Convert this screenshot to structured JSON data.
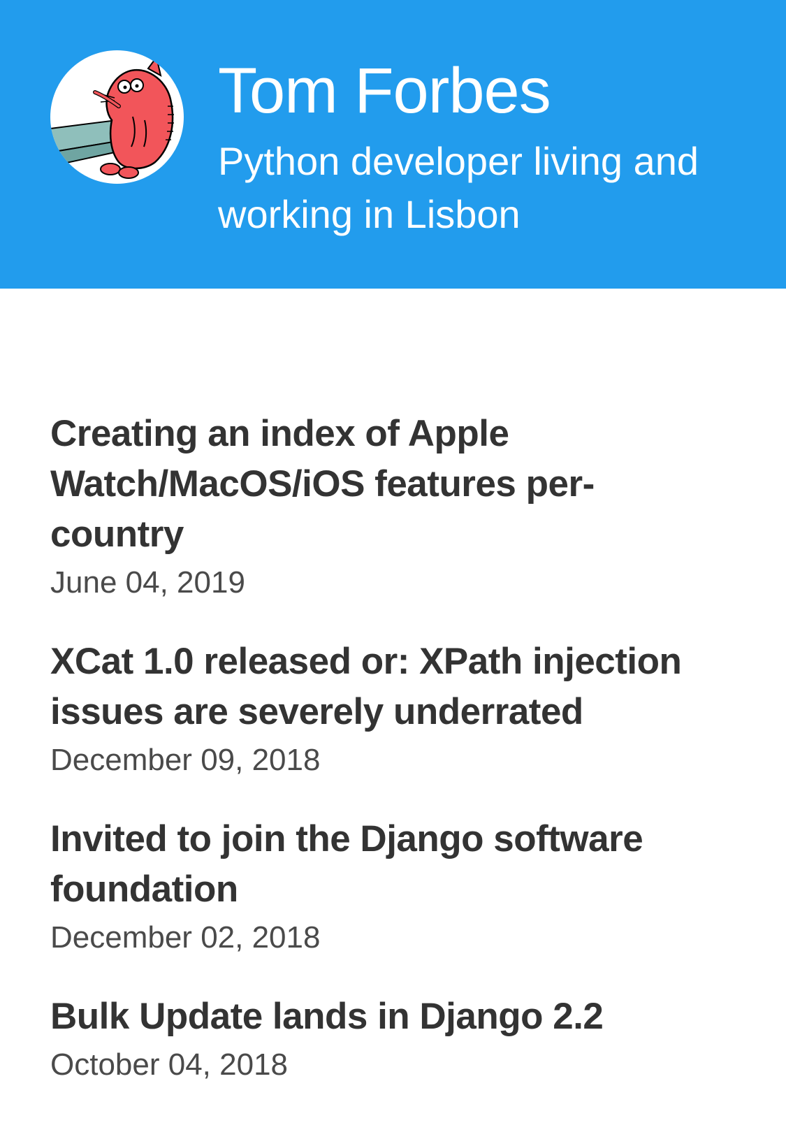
{
  "header": {
    "title": "Tom Forbes",
    "tagline": "Python developer living and working in Lisbon",
    "background_color": "#229ced",
    "avatar_icon": "cartoon-cat-avatar-icon"
  },
  "posts": [
    {
      "title": "Creating an index of Apple Watch/MacOS/iOS features per-country",
      "date": "June 04, 2019"
    },
    {
      "title": "XCat 1.0 released or: XPath injection issues are severely underrated",
      "date": "December 09, 2018"
    },
    {
      "title": "Invited to join the Django software foundation",
      "date": "December 02, 2018"
    },
    {
      "title": "Bulk Update lands in Django 2.2",
      "date": "October 04, 2018"
    }
  ]
}
